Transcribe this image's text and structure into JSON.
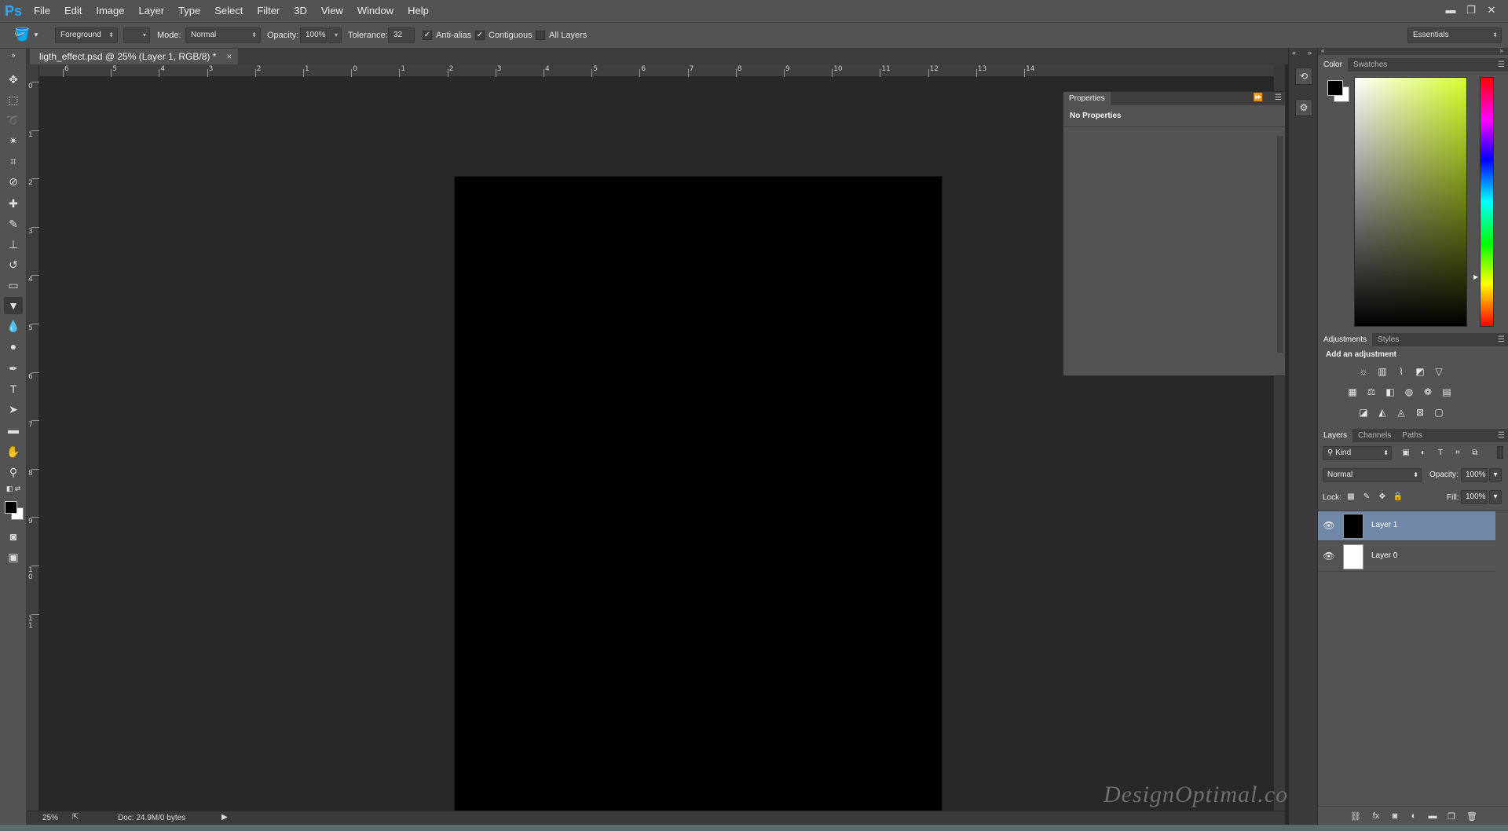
{
  "app": {
    "logo": "Ps"
  },
  "menu": [
    "File",
    "Edit",
    "Image",
    "Layer",
    "Type",
    "Select",
    "Filter",
    "3D",
    "View",
    "Window",
    "Help"
  ],
  "window_controls": {
    "minimize": "▬",
    "restore": "❐",
    "close": "✕"
  },
  "options_bar": {
    "fill_source": "Foreground",
    "mode_label": "Mode:",
    "mode_value": "Normal",
    "opacity_label": "Opacity:",
    "opacity_value": "100%",
    "tolerance_label": "Tolerance:",
    "tolerance_value": "32",
    "anti_alias_label": "Anti-alias",
    "anti_alias_checked": true,
    "contiguous_label": "Contiguous",
    "contiguous_checked": true,
    "all_layers_label": "All Layers",
    "all_layers_checked": false,
    "workspace": "Essentials"
  },
  "document": {
    "tab_title": "ligth_effect.psd @ 25% (Layer 1, RGB/8) *",
    "canvas_color": "#000000",
    "watermark": "DesignOptimal.com"
  },
  "ruler_h_labels": [
    "6",
    "5",
    "4",
    "3",
    "2",
    "1",
    "0",
    "1",
    "2",
    "3",
    "4",
    "5",
    "6",
    "7",
    "8",
    "9",
    "10",
    "11",
    "12",
    "13",
    "14"
  ],
  "ruler_v_labels": [
    "0",
    "1",
    "2",
    "3",
    "4",
    "5",
    "6",
    "7",
    "8",
    "9",
    "1\n0",
    "1\n1"
  ],
  "status": {
    "zoom": "25%",
    "doc_info": "Doc: 24.9M/0 bytes"
  },
  "properties_panel": {
    "tab": "Properties",
    "title": "No Properties"
  },
  "color_panel": {
    "tabs": [
      "Color",
      "Swatches"
    ],
    "fg": "#000000",
    "bg": "#ffffff",
    "hue_color": "#d7ff2a"
  },
  "adjustments_panel": {
    "tabs": [
      "Adjustments",
      "Styles"
    ],
    "title": "Add an adjustment"
  },
  "layers_panel": {
    "tabs": [
      "Layers",
      "Channels",
      "Paths"
    ],
    "filter_kind": "Kind",
    "blend_mode": "Normal",
    "opacity_label": "Opacity:",
    "opacity_value": "100%",
    "lock_label": "Lock:",
    "fill_label": "Fill:",
    "fill_value": "100%",
    "layers": [
      {
        "name": "Layer 1",
        "thumb_color": "#000000",
        "selected": true
      },
      {
        "name": "Layer 0",
        "thumb_color": "#ffffff",
        "selected": false
      }
    ]
  },
  "colors": {
    "selection": "#7187a8",
    "panel_bg": "#535353",
    "canvas_bg": "#282828"
  }
}
